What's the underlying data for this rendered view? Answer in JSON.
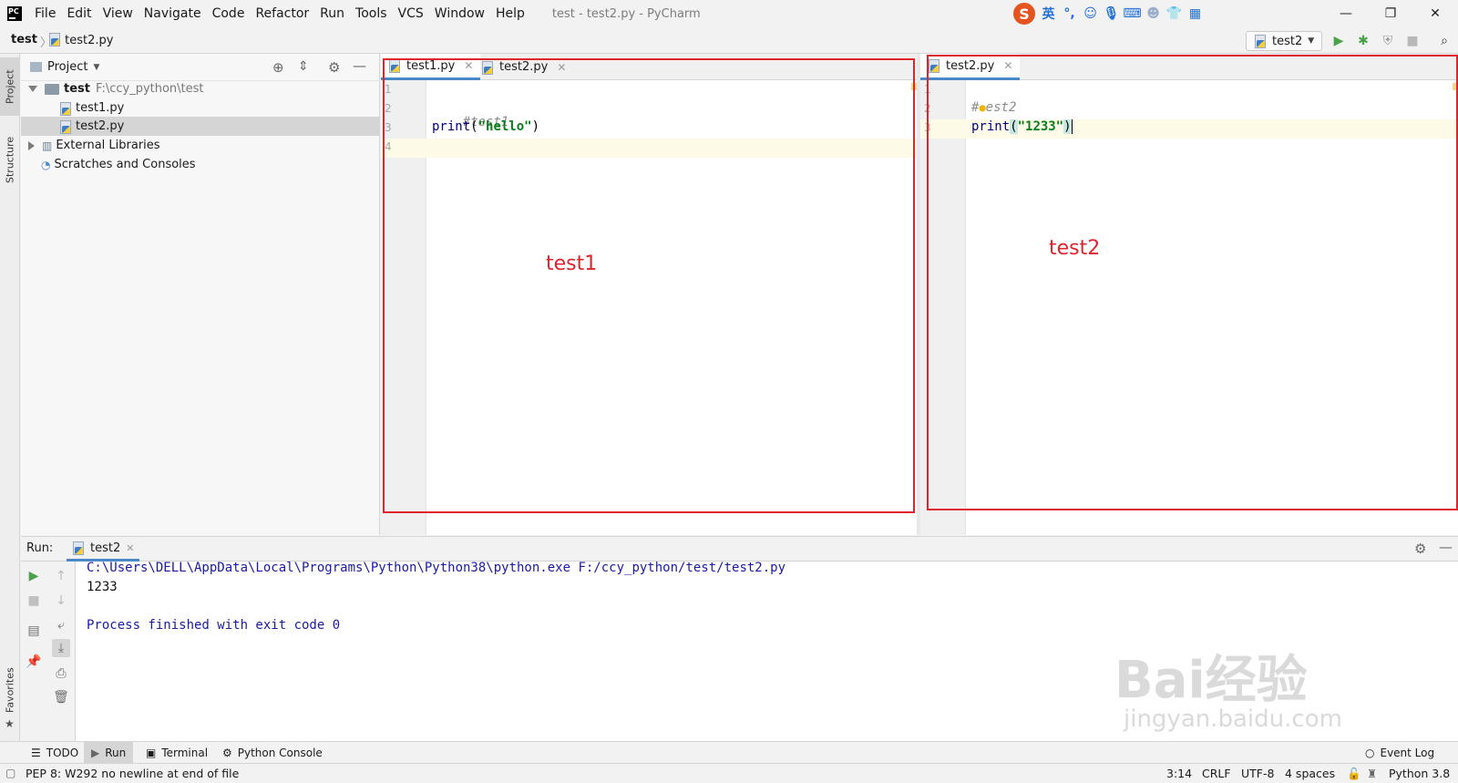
{
  "window": {
    "title": "test - test2.py - PyCharm",
    "menu": [
      "File",
      "Edit",
      "View",
      "Navigate",
      "Code",
      "Refactor",
      "Run",
      "Tools",
      "VCS",
      "Window",
      "Help"
    ]
  },
  "ime": {
    "lang": "英",
    "icons": [
      "sogou-icon",
      "punctuation-icon",
      "emoji-icon",
      "mic-icon",
      "keyboard-icon",
      "user-icon",
      "skin-icon",
      "toolbox-icon"
    ]
  },
  "breadcrumb": {
    "project": "test",
    "file": "test2.py"
  },
  "toolbar": {
    "run_config": "test2"
  },
  "sidebar": {
    "project_label": "Project",
    "structure_label": "Structure",
    "favorites_label": "Favorites"
  },
  "project_panel": {
    "title": "Project",
    "tree": [
      {
        "name": "test",
        "path": "F:\\ccy_python\\test",
        "type": "root"
      },
      {
        "name": "test1.py",
        "type": "file"
      },
      {
        "name": "test2.py",
        "type": "file",
        "selected": true
      },
      {
        "name": "External Libraries",
        "type": "lib"
      },
      {
        "name": "Scratches and Consoles",
        "type": "scratch"
      }
    ]
  },
  "editor_left": {
    "tabs": [
      {
        "label": "test1.py",
        "active": true
      },
      {
        "label": "test2.py",
        "active": false
      }
    ],
    "line_numbers": [
      "1",
      "2",
      "3",
      "4"
    ],
    "code": {
      "comment": "#test1",
      "fn": "print",
      "open": "(",
      "str": "\"hello\"",
      "close": ")"
    },
    "annotation": "test1"
  },
  "editor_right": {
    "tabs": [
      {
        "label": "test2.py",
        "active": true
      }
    ],
    "line_numbers": [
      "1",
      "2",
      "3"
    ],
    "code": {
      "comment_a": "#",
      "comment_b": "est2",
      "fn": "print",
      "open": "(",
      "str": "\"1233\"",
      "close": ")"
    },
    "annotation": "test2"
  },
  "run_panel": {
    "label": "Run:",
    "tab": "test2",
    "output": [
      "C:\\Users\\DELL\\AppData\\Local\\Programs\\Python\\Python38\\python.exe F:/ccy_python/test/test2.py",
      "1233",
      "",
      "Process finished with exit code 0"
    ]
  },
  "tool_tabs": {
    "todo": "TODO",
    "run": "Run",
    "terminal": "Terminal",
    "python_console": "Python Console",
    "event_log": "Event Log"
  },
  "status": {
    "message": "PEP 8: W292 no newline at end of file",
    "position": "3:14",
    "line_sep": "CRLF",
    "encoding": "UTF-8",
    "indent": "4 spaces",
    "interpreter": "Python 3.8"
  },
  "watermark": {
    "brand": "Bai经验",
    "url": "jingyan.baidu.com"
  },
  "colors": {
    "accent": "#4a88c7",
    "annotation": "#e0242c",
    "string": "#067d17",
    "function": "#000080",
    "output_link": "#1a1aa6"
  }
}
